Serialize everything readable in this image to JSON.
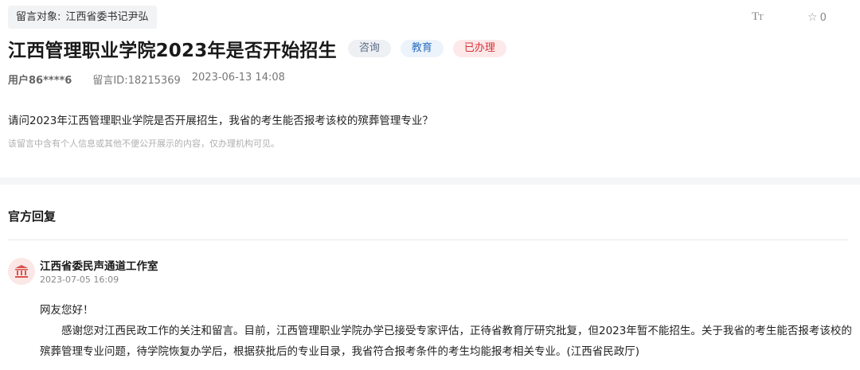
{
  "target": {
    "label": "留言对象",
    "value": "江西省委书记尹弘"
  },
  "toolbar": {
    "font_size_label": "T",
    "font_size_small": "T",
    "favorite_icon": "star-icon",
    "favorite_count": "0"
  },
  "message": {
    "title": "江西管理职业学院2023年是否开始招生",
    "tags": [
      {
        "label": "咨询",
        "color": "#5b6b86"
      },
      {
        "label": "教育",
        "color": "#2d6fbf"
      },
      {
        "label": "已办理",
        "color": "#d93035"
      }
    ],
    "user": "用户86****6",
    "message_id": "留言ID:18215369",
    "date": "2023-06-13 14:08",
    "question": "请问2023年江西管理职业学院是否开展招生，我省的考生能否报考该校的殡葬管理专业？",
    "privacy_note": "该留言中含有个人信息或其他不便公开展示的内容，仅办理机构可见。"
  },
  "reply": {
    "heading": "官方回复",
    "org_icon": "government-building-icon",
    "org_name": "江西省委民声通道工作室",
    "date": "2023-07-05 16:09",
    "greeting": "网友您好！",
    "body": "感谢您对江西民政工作的关注和留言。目前，江西管理职业学院办学已接受专家评估，正待省教育厅研究批复，但2023年暂不能招生。关于我省的考生能否报考该校的殡葬管理专业问题，待学院恢复办学后，根据获批后的专业目录，我省符合报考条件的考生均能报考相关专业。(江西省民政厅)"
  }
}
